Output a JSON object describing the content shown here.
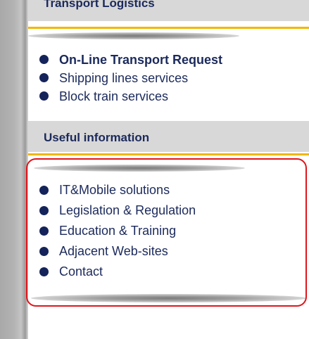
{
  "sections": {
    "transport": {
      "title": "Transport Logistics",
      "items": [
        {
          "label": "On-Line Transport Request"
        },
        {
          "label": "Shipping lines services"
        },
        {
          "label": "Block train services"
        }
      ]
    },
    "useful": {
      "title": "Useful information",
      "items": [
        {
          "label": "IT&Mobile solutions"
        },
        {
          "label": "Legislation & Regulation"
        },
        {
          "label": "Education & Training"
        },
        {
          "label": "Adjacent Web-sites"
        },
        {
          "label": "Contact"
        }
      ]
    }
  },
  "colors": {
    "header_bg": "#d8d8d8",
    "header_text": "#1b2a5c",
    "accent_line": "#f2b700",
    "bullet": "#14235a",
    "highlight_border": "#e0151b"
  }
}
